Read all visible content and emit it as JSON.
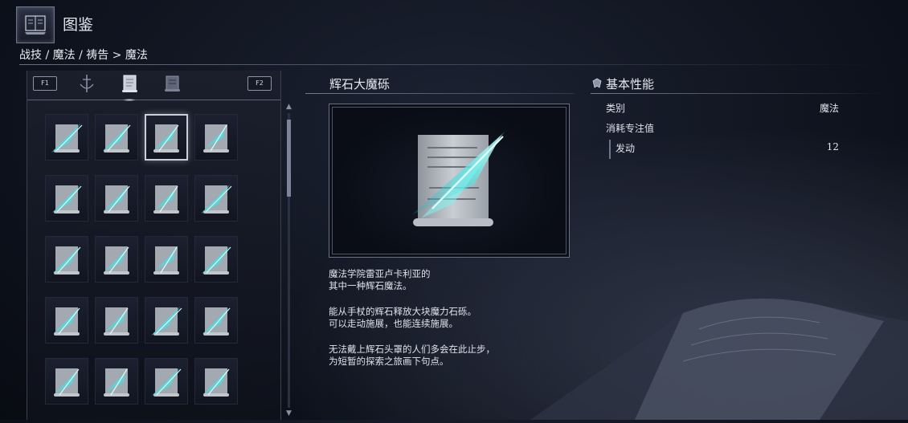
{
  "header": {
    "title": "图鉴",
    "breadcrumb": "战技 / 魔法 / 祷告 > 魔法"
  },
  "tabs": {
    "left_key": "F1",
    "right_key": "F2",
    "items": [
      "skills-icon",
      "sorceries-scroll-icon",
      "incantations-book-icon"
    ],
    "active_index": 1
  },
  "grid": {
    "columns": 4,
    "rows": 5,
    "selected_index": 2,
    "items": [
      "spell-scroll-icon",
      "spell-scroll-icon",
      "spell-scroll-icon",
      "spell-scroll-icon",
      "spell-scroll-icon",
      "spell-scroll-icon",
      "spell-scroll-icon",
      "spell-scroll-icon",
      "spell-scroll-icon",
      "spell-scroll-icon",
      "spell-scroll-icon",
      "spell-scroll-icon",
      "spell-scroll-icon",
      "spell-scroll-icon",
      "spell-scroll-icon",
      "spell-scroll-icon",
      "spell-scroll-icon",
      "spell-scroll-icon",
      "spell-scroll-icon",
      "spell-scroll-icon"
    ]
  },
  "item": {
    "name": "辉石大魔砾",
    "description": [
      "魔法学院雷亚卢卡利亚的\n其中一种辉石魔法。",
      "能从手杖的辉石释放大块魔力石砾。\n可以走动施展，也能连续施展。",
      "无法戴上辉石头罩的人们多会在此止步，\n为短暂的探索之旅画下句点。"
    ]
  },
  "stats": {
    "title": "基本性能",
    "category_label": "类别",
    "category_value": "魔法",
    "fp_label": "消耗专注值",
    "cast_label": "发动",
    "cast_value": "12"
  },
  "colors": {
    "accent_glow": "#5fe8e6",
    "text": "#dfe2ea",
    "frame": "#6a7187"
  }
}
